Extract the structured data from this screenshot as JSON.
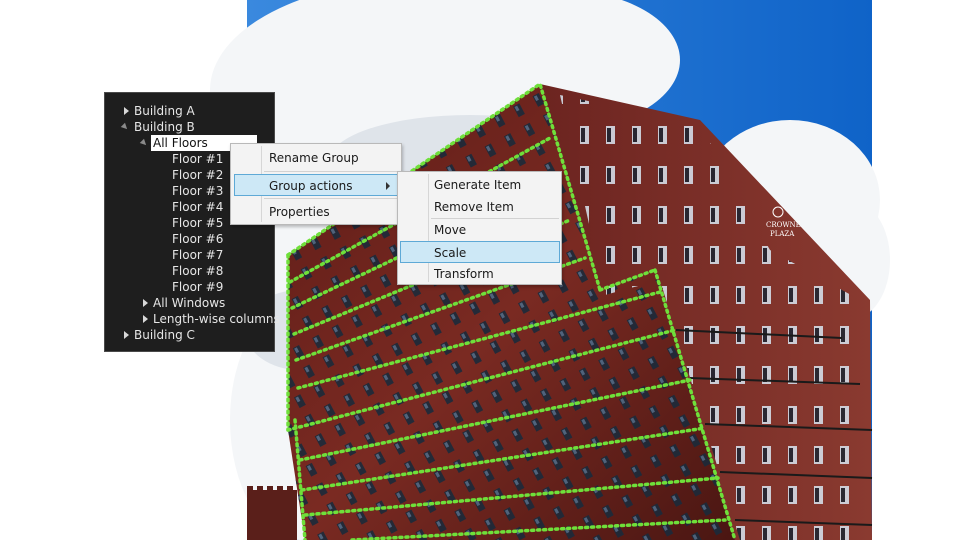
{
  "tree": {
    "nodes": [
      {
        "label": "Building A",
        "toggle": "collapsed"
      },
      {
        "label": "Building B",
        "toggle": "expanded"
      },
      {
        "label": "All Floors",
        "toggle": "expanded",
        "selected": true
      },
      {
        "label": "Floor #1",
        "toggle": "none"
      },
      {
        "label": "Floor #2",
        "toggle": "none"
      },
      {
        "label": "Floor #3",
        "toggle": "none"
      },
      {
        "label": "Floor #4",
        "toggle": "none"
      },
      {
        "label": "Floor #5",
        "toggle": "none"
      },
      {
        "label": "Floor #6",
        "toggle": "none"
      },
      {
        "label": "Floor #7",
        "toggle": "none"
      },
      {
        "label": "Floor #8",
        "toggle": "none"
      },
      {
        "label": "Floor #9",
        "toggle": "none"
      },
      {
        "label": "All Windows",
        "toggle": "collapsed"
      },
      {
        "label": "Length-wise columns",
        "toggle": "collapsed"
      },
      {
        "label": "Building C",
        "toggle": "collapsed"
      }
    ]
  },
  "context_menu": {
    "items": {
      "rename_group": "Rename Group",
      "group_actions": "Group actions",
      "properties": "Properties"
    },
    "submenu": {
      "generate_item": "Generate Item",
      "remove_item": "Remove Item",
      "move": "Move",
      "scale": "Scale",
      "transform": "Transform"
    }
  },
  "colors": {
    "overlay_dots": "#6fe03a",
    "sky": "#1a78d8",
    "brick": "#7a2a22",
    "menu_highlight": "#cde8f6"
  }
}
